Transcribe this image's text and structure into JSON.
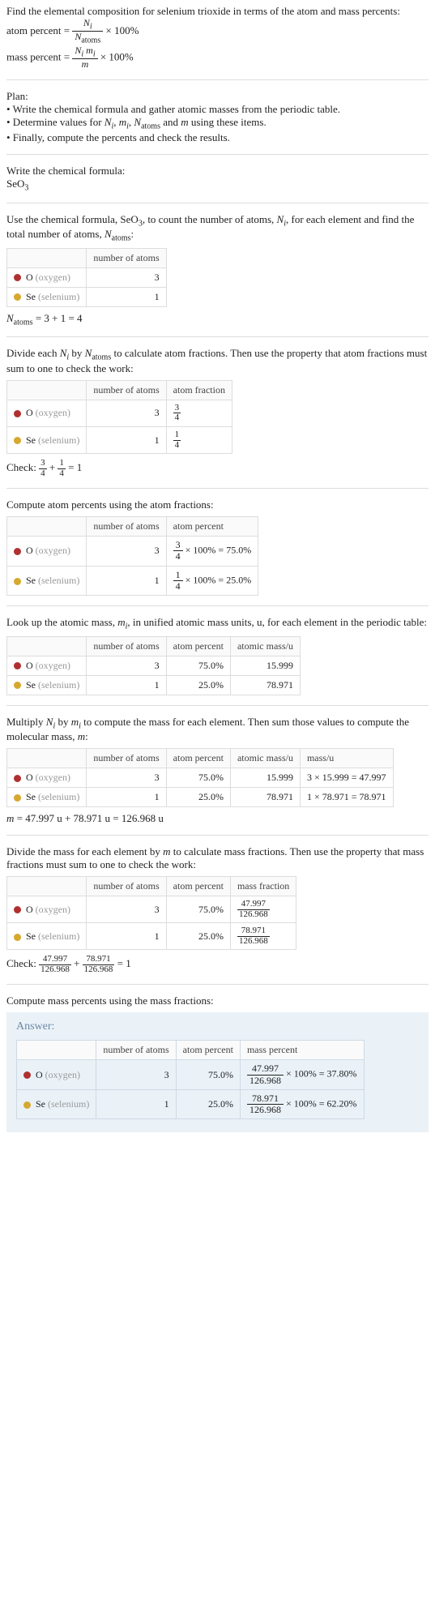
{
  "intro": {
    "line1": "Find the elemental composition for selenium trioxide in terms of the atom and mass percents:",
    "atom_percent_label": "atom percent = ",
    "atom_percent_frac_num": "N_i",
    "atom_percent_frac_den": "N_atoms",
    "times100": " × 100%",
    "mass_percent_label": "mass percent = ",
    "mass_percent_frac_num": "N_i m_i",
    "mass_percent_frac_den": "m"
  },
  "plan": {
    "heading": "Plan:",
    "b1": "• Write the chemical formula and gather atomic masses from the periodic table.",
    "b2_a": "• Determine values for ",
    "b2_n": "N_i",
    "b2_c": ", ",
    "b2_m": "m_i",
    "b2_c2": ", ",
    "b2_na": "N_atoms",
    "b2_and": " and ",
    "b2_mm": "m",
    "b2_end": " using these items.",
    "b3": "• Finally, compute the percents and check the results."
  },
  "formula": {
    "heading": "Write the chemical formula:",
    "value": "SeO",
    "sub": "3"
  },
  "count": {
    "text_a": "Use the chemical formula, SeO",
    "sub": "3",
    "text_b": ", to count the number of atoms, ",
    "ni": "N_i",
    "text_c": ", for each element and find the total number of atoms, ",
    "na": "N_atoms",
    "text_d": ":",
    "h_atoms": "number of atoms",
    "o_label": "O",
    "o_gray": " (oxygen)",
    "o_n": "3",
    "se_label": "Se",
    "se_gray": " (selenium)",
    "se_n": "1",
    "sum_a": "N_atoms",
    "sum_b": " = 3 + 1 = 4"
  },
  "fractions": {
    "text_a": "Divide each ",
    "ni": "N_i",
    "text_b": " by ",
    "na": "N_atoms",
    "text_c": " to calculate atom fractions. Then use the property that atom fractions must sum to one to check the work:",
    "h_atoms": "number of atoms",
    "h_frac": "atom fraction",
    "o_n": "3",
    "o_num": "3",
    "o_den": "4",
    "se_n": "1",
    "se_num": "1",
    "se_den": "4",
    "check_a": "Check: ",
    "check_b": " + ",
    "check_c": " = 1"
  },
  "percents": {
    "heading": "Compute atom percents using the atom fractions:",
    "h_atoms": "number of atoms",
    "h_pct": "atom percent",
    "o_n": "3",
    "o_num": "3",
    "o_den": "4",
    "o_res": " × 100% = 75.0%",
    "se_n": "1",
    "se_num": "1",
    "se_den": "4",
    "se_res": " × 100% = 25.0%"
  },
  "mass_lookup": {
    "text_a": "Look up the atomic mass, ",
    "mi": "m_i",
    "text_b": ", in unified atomic mass units, u, for each element in the periodic table:",
    "h_atoms": "number of atoms",
    "h_pct": "atom percent",
    "h_mass": "atomic mass/u",
    "o_n": "3",
    "o_pct": "75.0%",
    "o_m": "15.999",
    "se_n": "1",
    "se_pct": "25.0%",
    "se_m": "78.971"
  },
  "mass_mult": {
    "text_a": "Multiply ",
    "ni": "N_i",
    "text_b": " by ",
    "mi": "m_i",
    "text_c": " to compute the mass for each element. Then sum those values to compute the molecular mass, ",
    "m": "m",
    "text_d": ":",
    "h_atoms": "number of atoms",
    "h_pct": "atom percent",
    "h_amass": "atomic mass/u",
    "h_mass": "mass/u",
    "o_n": "3",
    "o_pct": "75.0%",
    "o_am": "15.999",
    "o_mass": "3 × 15.999 = 47.997",
    "se_n": "1",
    "se_pct": "25.0%",
    "se_am": "78.971",
    "se_mass": "1 × 78.971 = 78.971",
    "sum": "m = 47.997 u + 78.971 u = 126.968 u"
  },
  "mass_frac": {
    "text": "Divide the mass for each element by m to calculate mass fractions. Then use the property that mass fractions must sum to one to check the work:",
    "h_atoms": "number of atoms",
    "h_pct": "atom percent",
    "h_mf": "mass fraction",
    "o_n": "3",
    "o_pct": "75.0%",
    "o_num": "47.997",
    "o_den": "126.968",
    "se_n": "1",
    "se_pct": "25.0%",
    "se_num": "78.971",
    "se_den": "126.968",
    "check_a": "Check: ",
    "check_plus": " + ",
    "check_eq": " = 1"
  },
  "answer": {
    "heading": "Compute mass percents using the mass fractions:",
    "label": "Answer:",
    "h_atoms": "number of atoms",
    "h_pct": "atom percent",
    "h_mpct": "mass percent",
    "o_n": "3",
    "o_pct": "75.0%",
    "o_num": "47.997",
    "o_den": "126.968",
    "o_res": " × 100% = 37.80%",
    "se_n": "1",
    "se_pct": "25.0%",
    "se_num": "78.971",
    "se_den": "126.968",
    "se_res": " × 100% = 62.20%"
  }
}
